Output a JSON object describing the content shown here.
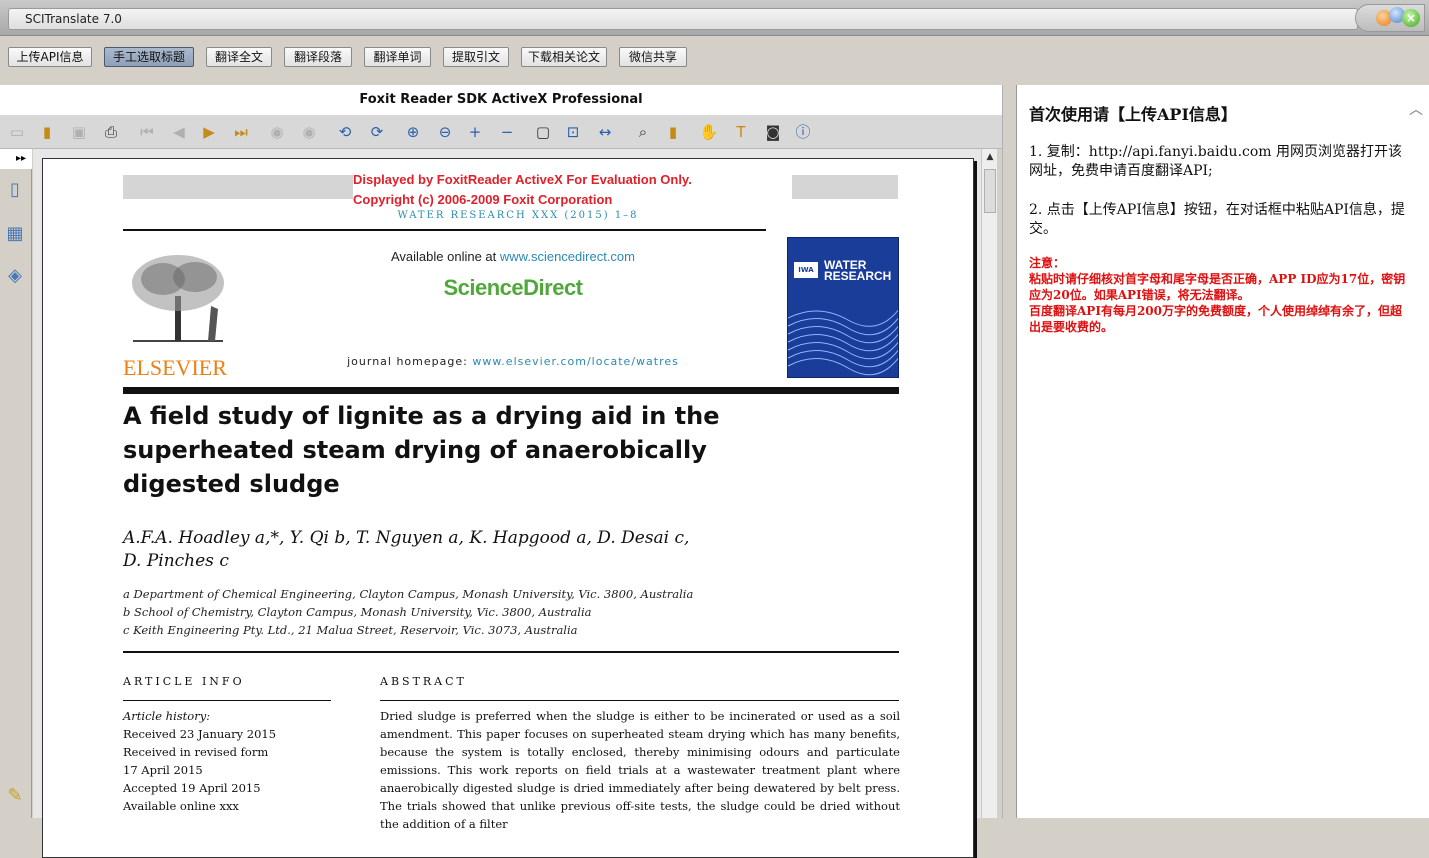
{
  "window": {
    "title": "SCITranslate 7.0"
  },
  "toolbar": {
    "buttons": [
      "上传API信息",
      "手工选取标题",
      "翻译全文",
      "翻译段落",
      "翻译单词",
      "提取引文",
      "下载相关论文",
      "微信共享"
    ]
  },
  "viewer": {
    "title": "Foxit Reader SDK ActiveX Professional",
    "tools": [
      "open-folder-icon",
      "open-file-icon",
      "save-icon",
      "print-icon",
      "first-page-icon",
      "previous-page-icon",
      "next-page-icon",
      "last-page-icon",
      "back-icon",
      "forward-icon",
      "rotate-left-icon",
      "rotate-right-icon",
      "zoom-in-icon",
      "zoom-out-icon",
      "plus-icon",
      "minus-icon",
      "actual-size-icon",
      "fit-page-icon",
      "fit-width-icon",
      "find-icon",
      "bookmark-icon",
      "hand-tool-icon",
      "text-select-icon",
      "snapshot-icon",
      "about-icon"
    ]
  },
  "page": {
    "eval_line1": "Displayed by FoxitReader ActiveX For Evaluation Only.",
    "eval_line2": "Copyright (c) 2006-2009 Foxit Corporation",
    "journal_line": "WATER RESEARCH XXX (2015) 1–8",
    "available_prefix": "Available online at ",
    "available_link": "www.sciencedirect.com",
    "sd_logo": "ScienceDirect",
    "homepage_prefix": "journal homepage: ",
    "homepage_link": "www.elsevier.com/locate/watres",
    "publisher": "ELSEVIER",
    "cover_title_1": "WATER",
    "cover_title_2": "RESEARCH",
    "cover_logo": "IWA",
    "title_l1": "A field study of lignite as a drying aid in the",
    "title_l2": "superheated steam drying of anaerobically",
    "title_l3": "digested sludge",
    "authors_l1": "A.F.A. Hoadley a,*, Y. Qi b, T. Nguyen a, K. Hapgood a, D. Desai c,",
    "authors_l2": "D. Pinches c",
    "affil_a": "a Department of Chemical Engineering, Clayton Campus, Monash University, Vic. 3800, Australia",
    "affil_b": "b School of Chemistry, Clayton Campus, Monash University, Vic. 3800, Australia",
    "affil_c": "c Keith Engineering Pty. Ltd., 21 Malua Street, Reservoir, Vic. 3073, Australia",
    "article_info_head": "ARTICLE INFO",
    "abstract_head": "ABSTRACT",
    "info_lines": [
      "Article history:",
      "Received 23 January 2015",
      "Received in revised form",
      "17 April 2015",
      "Accepted 19 April 2015",
      "Available online xxx"
    ],
    "abstract_text": "Dried sludge is preferred when the sludge is either to be incinerated or used as a soil amendment. This paper focuses on superheated steam drying which has many benefits, because the system is totally enclosed, thereby minimising odours and particulate emissions. This work reports on field trials at a wastewater treatment plant where anaerobically digested sludge is dried immediately after being dewatered by belt press. The trials showed that unlike previous off-site tests, the sludge could be dried without the addition of a filter"
  },
  "panel": {
    "heading": "首次使用请【上传API信息】",
    "step1": "1. 复制：http://api.fanyi.baidu.com 用网页浏览器打开该网址，免费申请百度翻译API;",
    "step2": "2. 点击【上传API信息】按钮，在对话框中粘贴API信息，提交。",
    "note_title": "注意：",
    "note1": "粘贴时请仔细核对首字母和尾字母是否正确，APP ID应为17位，密钥应为20位。如果API错误，将无法翻译。",
    "note2": "百度翻译API有每月200万字的免费额度，个人使用绰绰有余了，但超出是要收费的。"
  }
}
